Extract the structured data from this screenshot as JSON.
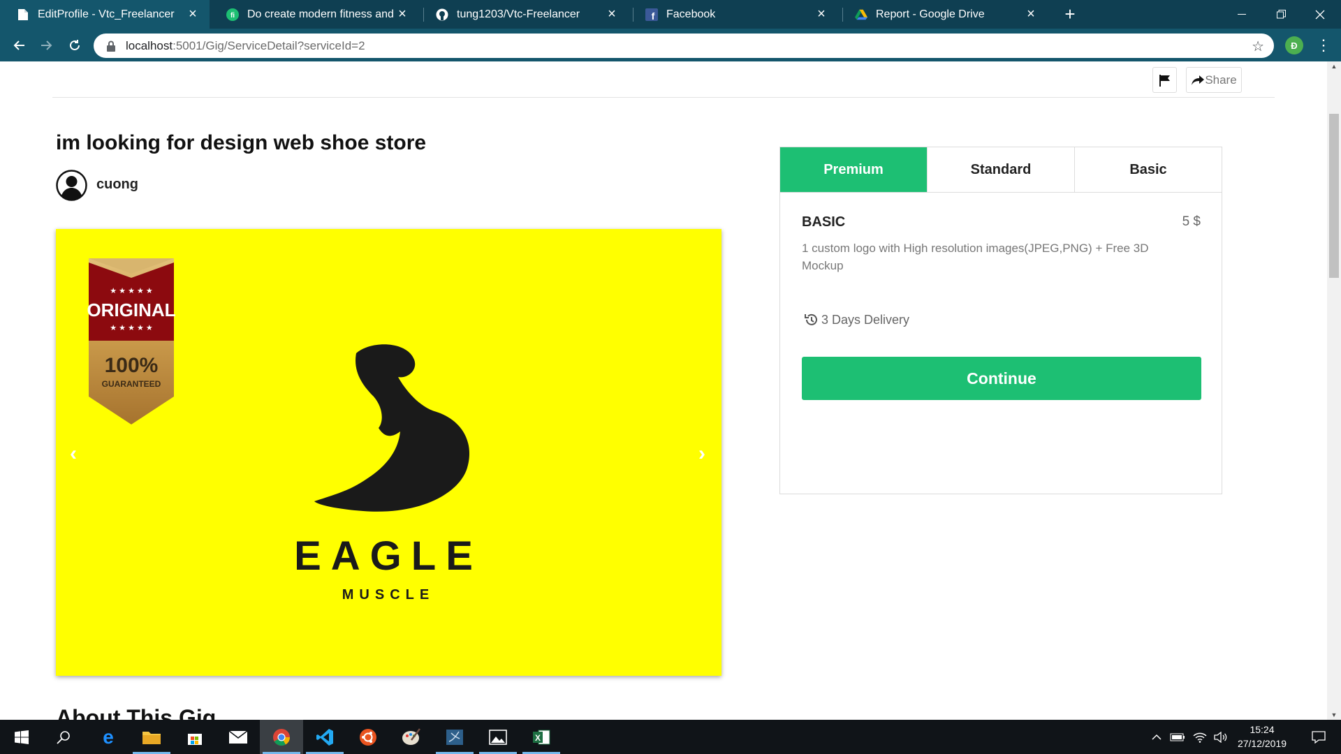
{
  "browser": {
    "tabs": [
      {
        "title": "EditProfile - Vtc_Freelancer",
        "icon": "document-icon",
        "active": true
      },
      {
        "title": "Do create modern fitness and gy",
        "icon": "fiverr-icon",
        "active": false
      },
      {
        "title": "tung1203/Vtc-Freelancer",
        "icon": "github-icon",
        "active": false
      },
      {
        "title": "Facebook",
        "icon": "facebook-icon",
        "active": false
      },
      {
        "title": "Report - Google Drive",
        "icon": "google-drive-icon",
        "active": false
      }
    ],
    "new_tab": "+",
    "url_host": "localhost",
    "url_path": ":5001/Gig/ServiceDetail?serviceId=2",
    "profile_initial": "Đ"
  },
  "page": {
    "share_label": "Share",
    "gig_title": "im looking for design web shoe store",
    "seller_name": "cuong",
    "about_heading": "About This Gig",
    "carousel": {
      "background": "#ffff00",
      "badge_top": "ORIGINAL",
      "badge_percent": "100%",
      "badge_bottom": "GUARANTEED",
      "logo_title": "EAGLE",
      "logo_subtitle": "MUSCLE"
    },
    "package": {
      "tabs": [
        "Premium",
        "Standard",
        "Basic"
      ],
      "active_tab": "Premium",
      "name": "BASIC",
      "price": "5 $",
      "description": "1 custom logo with High resolution images(JPEG,PNG) + Free 3D Mockup",
      "delivery": "3 Days Delivery",
      "continue_label": "Continue",
      "accent_color": "#1dbf73"
    }
  },
  "taskbar": {
    "time": "15:24",
    "date": "27/12/2019",
    "apps": [
      "windows-start-icon",
      "search-icon",
      "edge-icon",
      "file-explorer-icon",
      "store-icon",
      "mail-icon",
      "chrome-icon",
      "vscode-icon",
      "ubuntu-icon",
      "paint-icon",
      "sql-server-icon",
      "photos-icon",
      "excel-icon"
    ]
  }
}
